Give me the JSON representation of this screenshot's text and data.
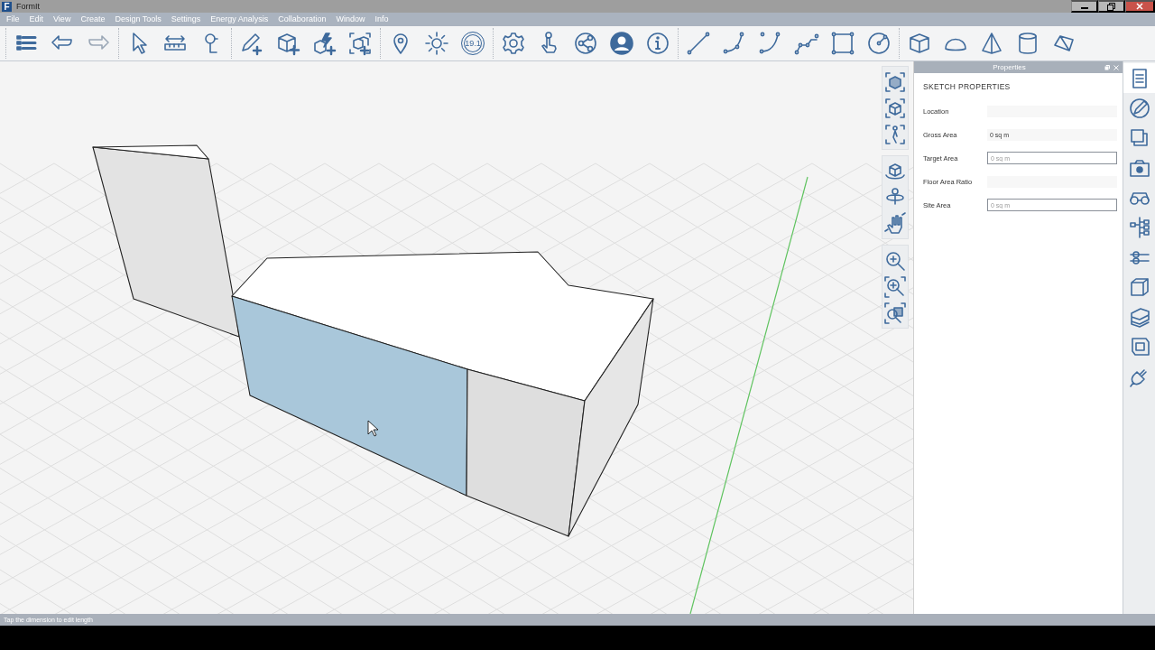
{
  "window": {
    "app_icon": "F",
    "title": "FormIt"
  },
  "menu": [
    "File",
    "Edit",
    "View",
    "Create",
    "Design Tools",
    "Settings",
    "Energy Analysis",
    "Collaboration",
    "Window",
    "Info"
  ],
  "toolbar": {
    "version_badge": "19.1"
  },
  "properties": {
    "title": "Properties",
    "heading": "SKETCH PROPERTIES",
    "fields": [
      {
        "label": "Location",
        "kind": "readonly"
      },
      {
        "label": "Gross Area",
        "kind": "readonly",
        "value": "0 sq m"
      },
      {
        "label": "Target Area",
        "kind": "input",
        "placeholder": "0 sq m"
      },
      {
        "label": "Floor Area Ratio",
        "kind": "readonly"
      },
      {
        "label": "Site Area",
        "kind": "input",
        "placeholder": "0 sq m"
      }
    ]
  },
  "side_tabs": [
    {
      "selected": true
    },
    {
      "selected": false
    },
    {
      "selected": false
    },
    {
      "selected": false
    },
    {
      "selected": false
    },
    {
      "selected": false
    },
    {
      "selected": false
    },
    {
      "selected": false
    },
    {
      "selected": false
    },
    {
      "selected": false
    },
    {
      "selected": false
    }
  ],
  "status_bar": "Tap the dimension to edit length"
}
